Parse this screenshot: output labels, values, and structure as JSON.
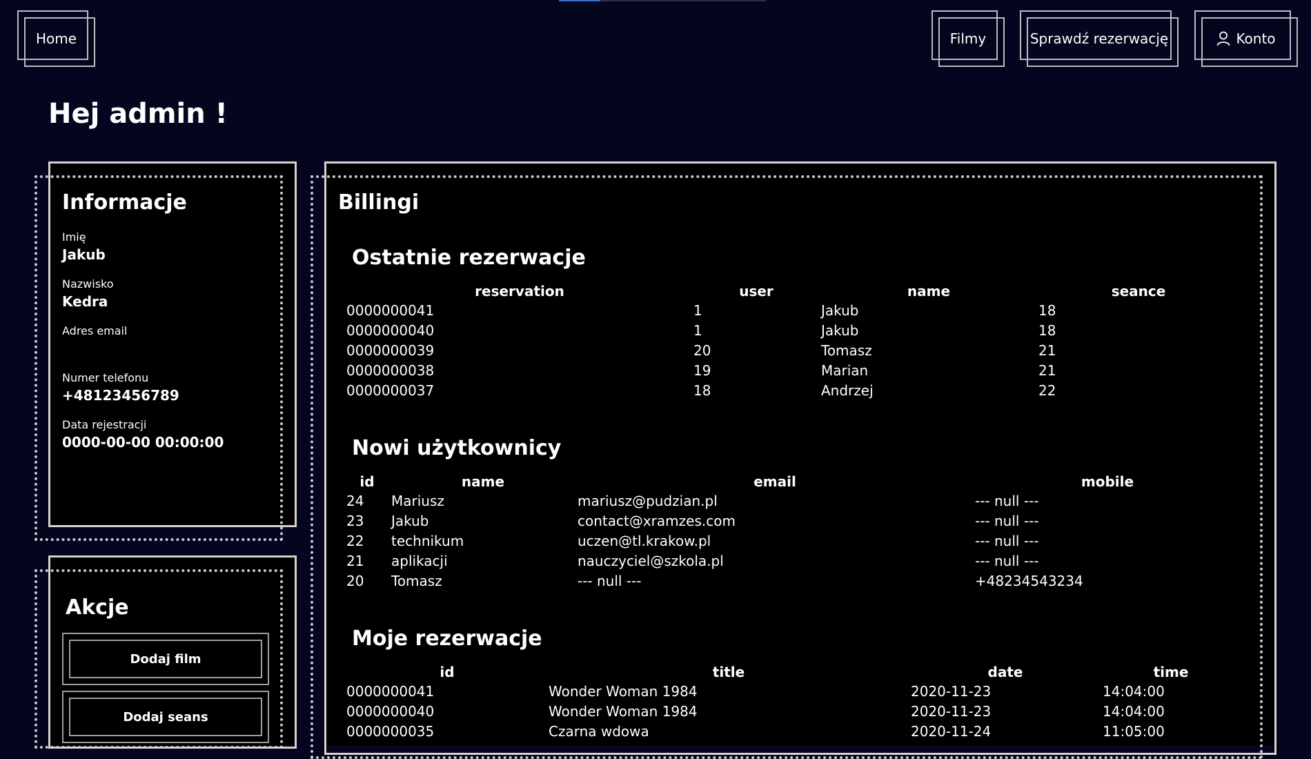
{
  "nav": {
    "home": "Home",
    "movies": "Filmy",
    "check_reservation": "Sprawdź rezerwację",
    "account": "Konto",
    "account_icon": "user-icon"
  },
  "greeting": "Hej admin !",
  "info": {
    "title": "Informacje",
    "fields": [
      {
        "label": "Imię",
        "value": "Jakub"
      },
      {
        "label": "Nazwisko",
        "value": "Kedra"
      },
      {
        "label": "Adres email",
        "value": ""
      },
      {
        "label": "Numer telefonu",
        "value": "+48123456789"
      },
      {
        "label": "Data rejestracji",
        "value": "0000-00-00 00:00:00"
      }
    ]
  },
  "actions": {
    "title": "Akcje",
    "add_movie": "Dodaj film",
    "add_seance": "Dodaj seans"
  },
  "billing": {
    "title": "Billingi",
    "recent_reservations": {
      "title": "Ostatnie rezerwacje",
      "headers": [
        "reservation",
        "user",
        "name",
        "seance"
      ],
      "rows": [
        [
          "0000000041",
          "1",
          "Jakub",
          "18"
        ],
        [
          "0000000040",
          "1",
          "Jakub",
          "18"
        ],
        [
          "0000000039",
          "20",
          "Tomasz",
          "21"
        ],
        [
          "0000000038",
          "19",
          "Marian",
          "21"
        ],
        [
          "0000000037",
          "18",
          "Andrzej",
          "22"
        ]
      ]
    },
    "new_users": {
      "title": "Nowi użytkownicy",
      "headers": [
        "id",
        "name",
        "email",
        "mobile"
      ],
      "rows": [
        [
          "24",
          "Mariusz",
          "mariusz@pudzian.pl",
          "--- null ---"
        ],
        [
          "23",
          "Jakub",
          "contact@xramzes.com",
          "--- null ---"
        ],
        [
          "22",
          "technikum",
          "uczen@tl.krakow.pl",
          "--- null ---"
        ],
        [
          "21",
          "aplikacji",
          "nauczyciel@szkola.pl",
          "--- null ---"
        ],
        [
          "20",
          "Tomasz",
          "--- null ---",
          "+48234543234"
        ]
      ]
    },
    "my_reservations": {
      "title": "Moje rezerwacje",
      "headers": [
        "id",
        "title",
        "date",
        "time"
      ],
      "rows": [
        [
          "0000000041",
          "Wonder Woman 1984",
          "2020-11-23",
          "14:04:00"
        ],
        [
          "0000000040",
          "Wonder Woman 1984",
          "2020-11-23",
          "14:04:00"
        ],
        [
          "0000000035",
          "Czarna wdowa",
          "2020-11-24",
          "11:05:00"
        ]
      ]
    }
  }
}
